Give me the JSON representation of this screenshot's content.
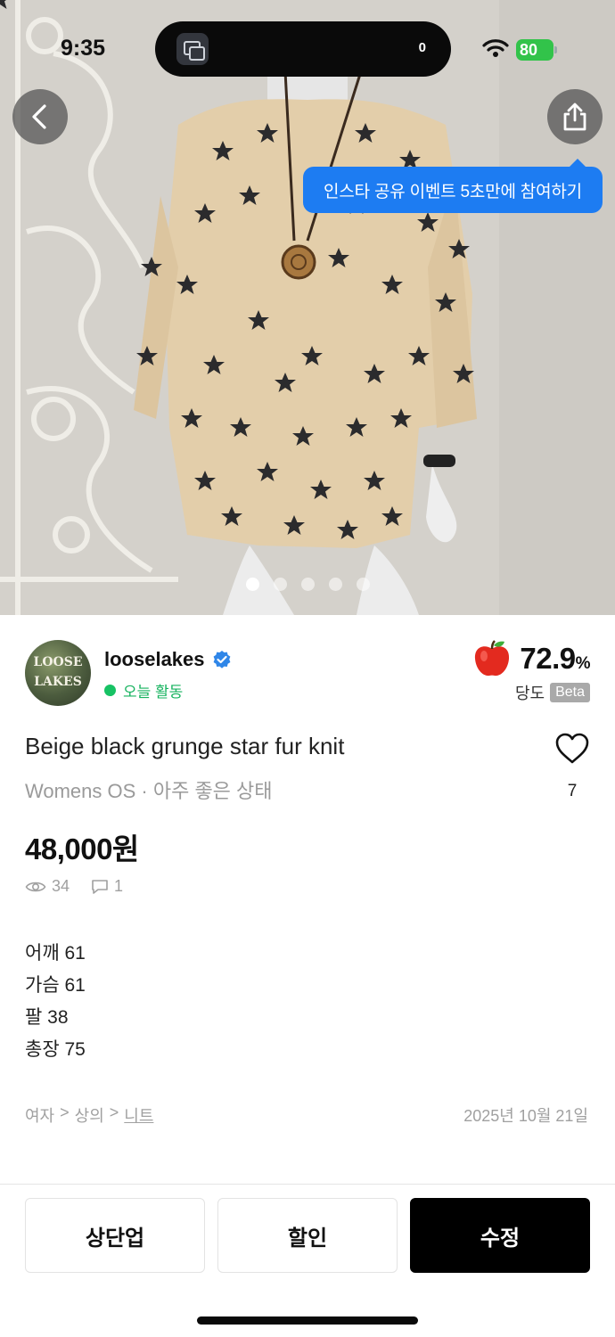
{
  "status_bar": {
    "time": "9:35",
    "island_count": "0",
    "battery": "80"
  },
  "hero": {
    "tooltip": "인스타 공유 이벤트 5초만에 참여하기",
    "carousel": {
      "count": 5,
      "active_index": 0
    }
  },
  "seller": {
    "avatar_text": [
      "LOOSE",
      "LAKES"
    ],
    "name": "looselakes",
    "activity": "오늘 활동",
    "score": "72.9",
    "score_unit": "%",
    "score_label": "당도",
    "score_badge": "Beta"
  },
  "product": {
    "title": "Beige black grunge star fur knit",
    "subtitle": "Womens OS · 아주 좋은 상태",
    "likes": "7",
    "price": "48,000원",
    "views": "34",
    "comments": "1",
    "description": [
      "어깨 61",
      "가슴 61",
      "팔 38",
      "총장 75"
    ],
    "breadcrumb": [
      "여자",
      ">",
      "상의",
      ">",
      "니트"
    ],
    "date": "2025년 10월 21일"
  },
  "actions": {
    "bump": "상단업",
    "discount": "할인",
    "edit": "수정"
  },
  "colors": {
    "accent": "#1d7cf2",
    "active_green": "#17b35f",
    "primary_button": "#000000"
  },
  "icons": [
    "back-icon",
    "share-icon",
    "verified-icon",
    "apple-icon",
    "heart-icon",
    "eye-icon",
    "comment-icon",
    "wifi-icon"
  ]
}
